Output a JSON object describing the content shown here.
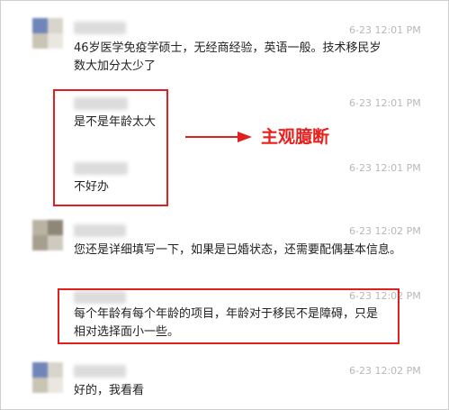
{
  "messages": [
    {
      "time": "6-23 12:01 PM",
      "text": "46岁医学免疫学硕士，无经商经验，英语一般。技术移民岁数大加分太少了"
    },
    {
      "time": "6-23 12:01 PM",
      "text": "是不是年龄太大"
    },
    {
      "time": "6-23 12:01 PM",
      "text": "不好办"
    },
    {
      "time": "6-23 12:02 PM",
      "text": "您还是详细填写一下，如果是已婚状态，还需要配偶基本信息。"
    },
    {
      "time": "6-23 12:02 PM",
      "text": "每个年龄有每个年龄的项目，年龄对于移民不是障碍，只是相对选择面小一些。"
    },
    {
      "time": "6-23 12:02 PM",
      "text": "好的，我看看"
    }
  ],
  "annotation": {
    "label": "主观臆断",
    "color": "#e8201c"
  }
}
